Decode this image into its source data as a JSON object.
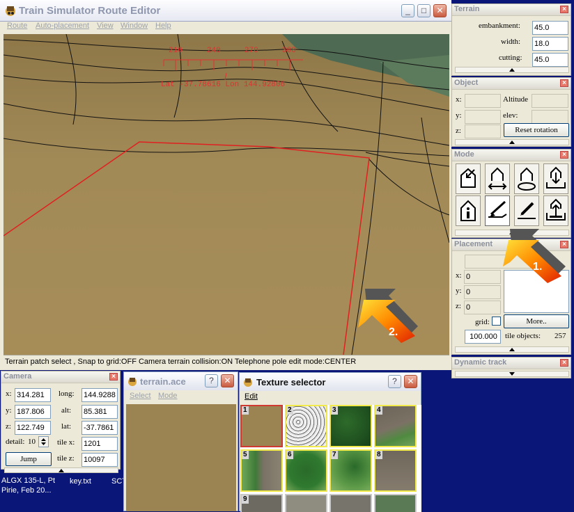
{
  "main_window": {
    "title": "Train Simulator Route Editor",
    "menu": [
      "Route",
      "Auto-placement",
      "View",
      "Window",
      "Help"
    ],
    "minimize_glyph": "_",
    "maximize_glyph": "□",
    "close_glyph": "✕"
  },
  "viewport": {
    "compass_ticks": [
      "210",
      "240",
      "270",
      "300"
    ],
    "coords": "Lat -37.78616 Lon 144.92806"
  },
  "status_bar": "Terrain patch select , Snap to grid:OFF Camera terrain collision:ON Telephone pole edit mode:CENTER",
  "terrain_panel": {
    "title": "Terrain",
    "embankment_label": "embankment:",
    "embankment_value": "45.0",
    "width_label": "width:",
    "width_value": "18.0",
    "cutting_label": "cutting:",
    "cutting_value": "45.0"
  },
  "object_panel": {
    "title": "Object",
    "x_label": "x:",
    "y_label": "y:",
    "z_label": "z:",
    "altitude_label": "Altitude",
    "elev_label": "elev:",
    "reset_rotation_label": "Reset rotation"
  },
  "mode_panel": {
    "title": "Mode",
    "buttons": [
      "place-object",
      "move-object",
      "rotate-object",
      "lower-object",
      "object-info",
      "terrain-brush",
      "terrain-pencil",
      "raise-object"
    ]
  },
  "placement_panel": {
    "title": "Placement",
    "x_label": "x:",
    "x_value": "0",
    "y_label": "y:",
    "y_value": "0",
    "z_label": "z:",
    "z_value": "0",
    "grid_label": "grid:",
    "more_label": "More..",
    "distance_value": "100.000",
    "tile_objects_label": "tile objects:",
    "tile_objects_value": "257"
  },
  "dynamic_track_panel": {
    "title": "Dynamic track"
  },
  "annotations": {
    "arrow1_label": "1.",
    "arrow2_label": "2."
  },
  "camera_panel": {
    "title": "Camera",
    "x_label": "x:",
    "x_value": "314.281",
    "y_label": "y:",
    "y_value": "187.806",
    "z_label": "z:",
    "z_value": "122.749",
    "long_label": "long:",
    "long_value": "144.9288",
    "alt_label": "alt:",
    "alt_value": "85.381",
    "lat_label": "lat:",
    "lat_value": "-37.7861",
    "detail_label": "detail:",
    "detail_value": "10",
    "tilex_label": "tile x:",
    "tilex_value": "1201",
    "tilez_label": "tile z:",
    "tilez_value": "10097",
    "jump_label": "Jump"
  },
  "terrain_ace_window": {
    "title": "terrain.ace",
    "menu": [
      "Select",
      "Mode"
    ],
    "help_glyph": "?",
    "close_glyph": "✕"
  },
  "texture_selector": {
    "title": "Texture selector",
    "menu": [
      "Edit"
    ],
    "help_glyph": "?",
    "close_glyph": "✕",
    "tiles": [
      "1",
      "2",
      "3",
      "4",
      "5",
      "6",
      "7",
      "8",
      "9"
    ]
  },
  "desktop": {
    "icon1_label_line1": "ALGX 135-L, Pt",
    "icon1_label_line2": "Pirie, Feb 20...",
    "icon2_label": "key.txt",
    "icon3_label": "SCT"
  },
  "colors": {
    "terrain_ground": "#9c8452",
    "selection_outline": "#e02020",
    "compass_text": "#e03030",
    "desktop_bg": "#0a1678",
    "texture_border": "#f2e94a"
  }
}
